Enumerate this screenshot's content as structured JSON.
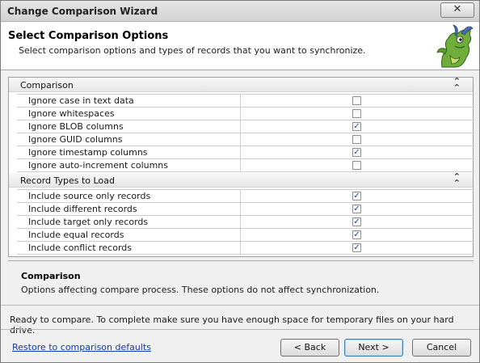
{
  "window": {
    "title": "Change Comparison Wizard",
    "close_label": "✕"
  },
  "header": {
    "title": "Select Comparison Options",
    "subtitle": "Select comparison options and types of records that you want to synchronize."
  },
  "sections": [
    {
      "label": "Comparison",
      "rows": [
        {
          "label": "Ignore case in text data",
          "checked": false
        },
        {
          "label": "Ignore whitespaces",
          "checked": false
        },
        {
          "label": "Ignore BLOB columns",
          "checked": true
        },
        {
          "label": "Ignore GUID columns",
          "checked": false
        },
        {
          "label": "Ignore timestamp columns",
          "checked": true
        },
        {
          "label": "Ignore auto-increment columns",
          "checked": false
        }
      ]
    },
    {
      "label": "Record Types to Load",
      "rows": [
        {
          "label": "Include source only records",
          "checked": true
        },
        {
          "label": "Include different records",
          "checked": true
        },
        {
          "label": "Include target only records",
          "checked": true
        },
        {
          "label": "Include equal records",
          "checked": true
        },
        {
          "label": "Include conflict records",
          "checked": true
        }
      ]
    }
  ],
  "description": {
    "title": "Comparison",
    "text": "Options affecting compare process. These options do not affect synchronization."
  },
  "status": "Ready to compare. To complete make sure you have enough space for temporary files on your hard drive.",
  "footer": {
    "restore_link": "Restore to comparison defaults",
    "back_label": "< Back",
    "next_label": "Next >",
    "cancel_label": "Cancel"
  },
  "icons": {
    "collapse": "double-chevron-up-icon",
    "check": "checkmark-icon",
    "mascot": "dragon-mascot-icon"
  }
}
